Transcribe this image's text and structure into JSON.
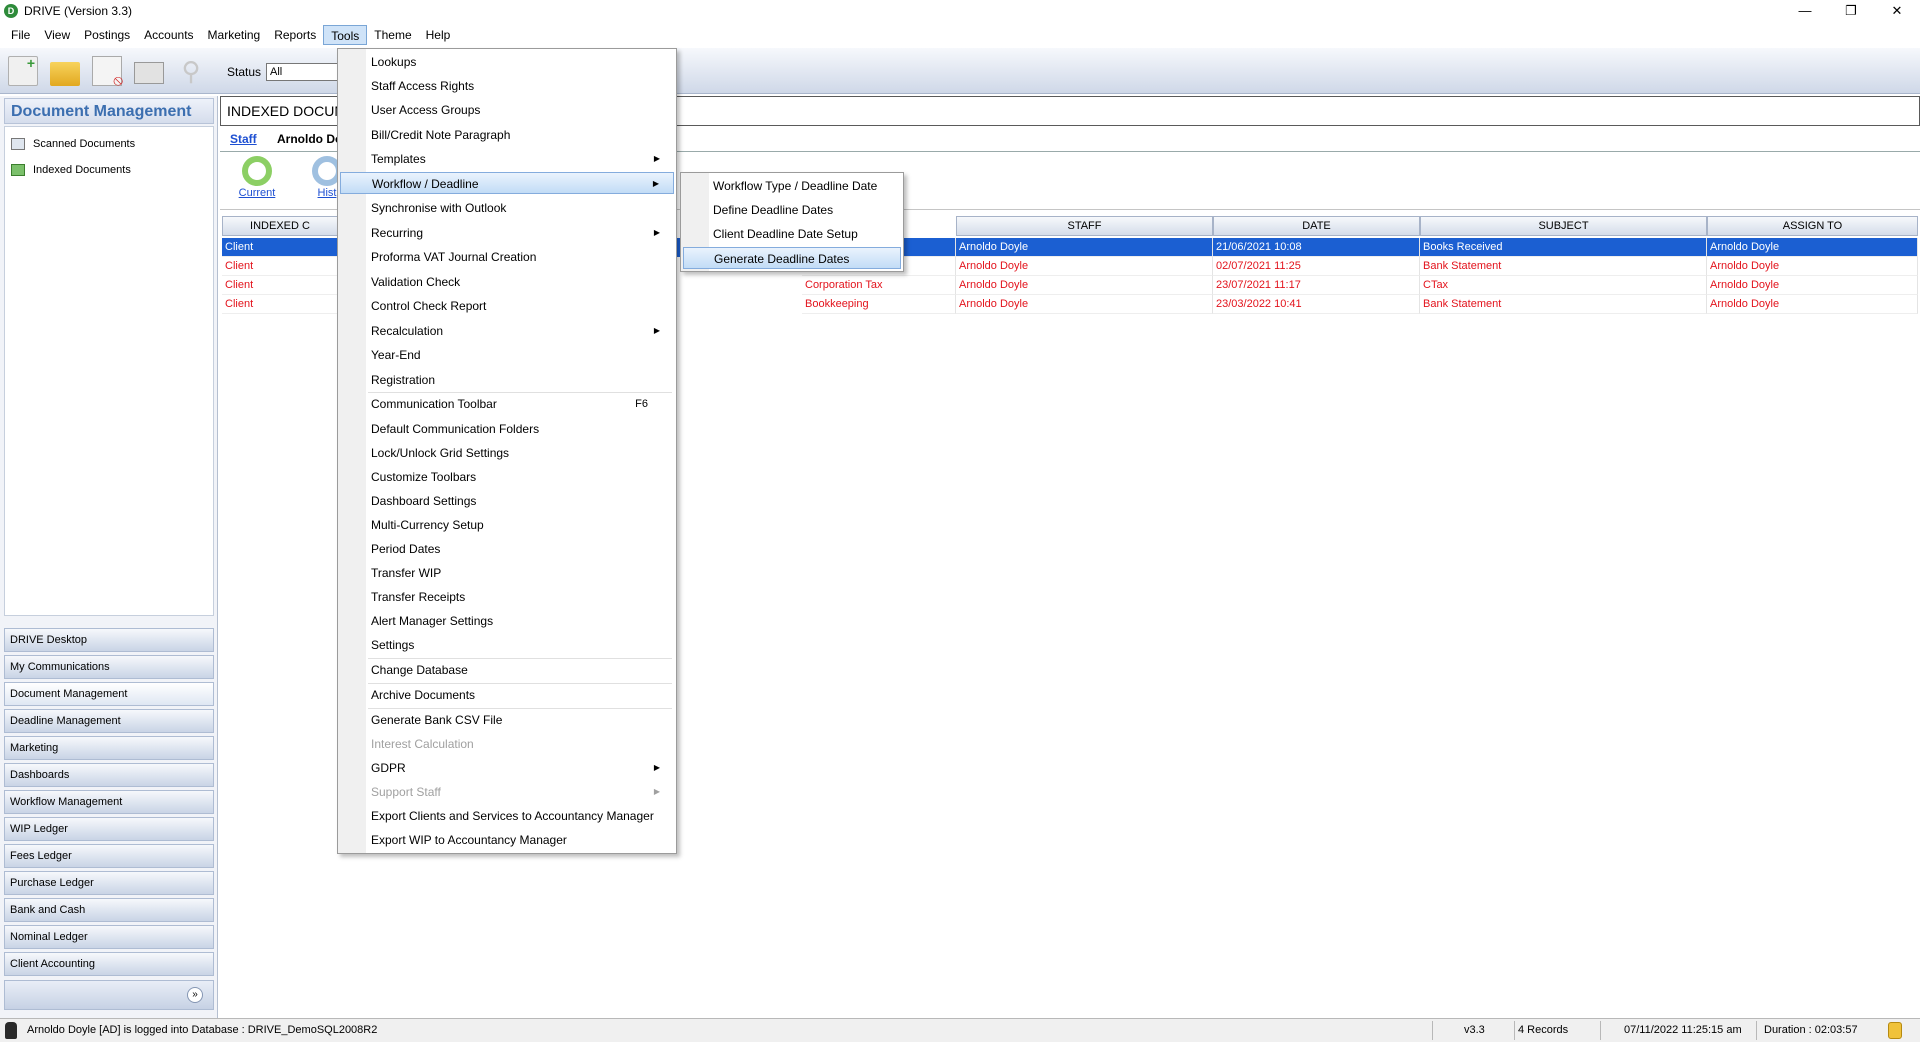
{
  "window": {
    "title": "DRIVE (Version 3.3)",
    "app_icon": "D",
    "minimize": "—",
    "maximize": "❐",
    "close": "✕"
  },
  "menubar": [
    "File",
    "View",
    "Postings",
    "Accounts",
    "Marketing",
    "Reports",
    "Tools",
    "Theme",
    "Help"
  ],
  "toolbar": {
    "status_label": "Status",
    "status_value": "All"
  },
  "left_panel": {
    "title": "Document Management",
    "tree": [
      "Scanned Documents",
      "Indexed Documents"
    ],
    "nav": [
      "DRIVE Desktop",
      "My Communications",
      "Document Management",
      "Deadline Management",
      "Marketing",
      "Dashboards",
      "Workflow Management",
      "WIP Ledger",
      "Fees Ledger",
      "Purchase Ledger",
      "Bank and Cash",
      "Nominal Ledger",
      "Client Accounting"
    ],
    "expand_icon": "»"
  },
  "main": {
    "title": "INDEXED DOCUM",
    "tab_staff": "Staff",
    "tab_staff_name": "Arnoldo Do",
    "view_current": "Current",
    "view_history": "Hist"
  },
  "grid": {
    "headers": [
      "INDEXED C",
      "STAFF",
      "DATE",
      "SUBJECT",
      "ASSIGN TO"
    ],
    "rows": [
      [
        "Client",
        "",
        "Arnoldo Doyle",
        "21/06/2021 10:08",
        "Books Received",
        "Arnoldo Doyle"
      ],
      [
        "Client",
        "",
        "Arnoldo Doyle",
        "02/07/2021 11:25",
        "Bank Statement",
        "Arnoldo Doyle"
      ],
      [
        "Client",
        "Corporation Tax",
        "Arnoldo Doyle",
        "23/07/2021 11:17",
        "CTax",
        "Arnoldo Doyle"
      ],
      [
        "Client",
        "Bookkeeping",
        "Arnoldo Doyle",
        "23/03/2022 10:41",
        "Bank Statement",
        "Arnoldo Doyle"
      ]
    ]
  },
  "tools_menu": {
    "items": [
      {
        "label": "Lookups"
      },
      {
        "label": "Staff Access Rights"
      },
      {
        "label": "User Access Groups"
      },
      {
        "label": "Bill/Credit Note Paragraph"
      },
      {
        "label": "Templates",
        "arrow": "▶"
      },
      {
        "label": "Workflow / Deadline",
        "arrow": "▶"
      },
      {
        "label": "Synchronise with Outlook"
      },
      {
        "label": "Recurring",
        "arrow": "▶"
      },
      {
        "label": "Proforma VAT Journal Creation"
      },
      {
        "label": "Validation Check"
      },
      {
        "label": "Control Check Report"
      },
      {
        "label": "Recalculation",
        "arrow": "▶"
      },
      {
        "label": "Year-End"
      },
      {
        "label": "Registration"
      },
      {
        "label": "Communication Toolbar",
        "shortcut": "F6"
      },
      {
        "label": "Default Communication Folders"
      },
      {
        "label": "Lock/Unlock Grid Settings"
      },
      {
        "label": "Customize Toolbars"
      },
      {
        "label": "Dashboard Settings"
      },
      {
        "label": "Multi-Currency Setup"
      },
      {
        "label": "Period Dates"
      },
      {
        "label": "Transfer WIP"
      },
      {
        "label": "Transfer Receipts"
      },
      {
        "label": "Alert Manager Settings"
      },
      {
        "label": "Settings"
      },
      {
        "label": "Change Database"
      },
      {
        "label": "Archive Documents"
      },
      {
        "label": "Generate Bank CSV File"
      },
      {
        "label": "Interest Calculation"
      },
      {
        "label": "GDPR",
        "arrow": "▶"
      },
      {
        "label": "Support Staff",
        "arrow": "▶"
      },
      {
        "label": "Export Clients and Services to Accountancy Manager"
      },
      {
        "label": "Export WIP to Accountancy Manager"
      }
    ]
  },
  "submenu": {
    "items": [
      "Workflow Type / Deadline Date",
      "Define Deadline Dates",
      "Client Deadline Date Setup",
      "Generate Deadline Dates"
    ]
  },
  "statusbar": {
    "login": "Arnoldo Doyle [AD] is logged into Database : DRIVE_DemoSQL2008R2",
    "version": "v3.3",
    "records": "4 Records",
    "datetime": "07/11/2022 11:25:15 am",
    "duration": "Duration : 02:03:57"
  }
}
